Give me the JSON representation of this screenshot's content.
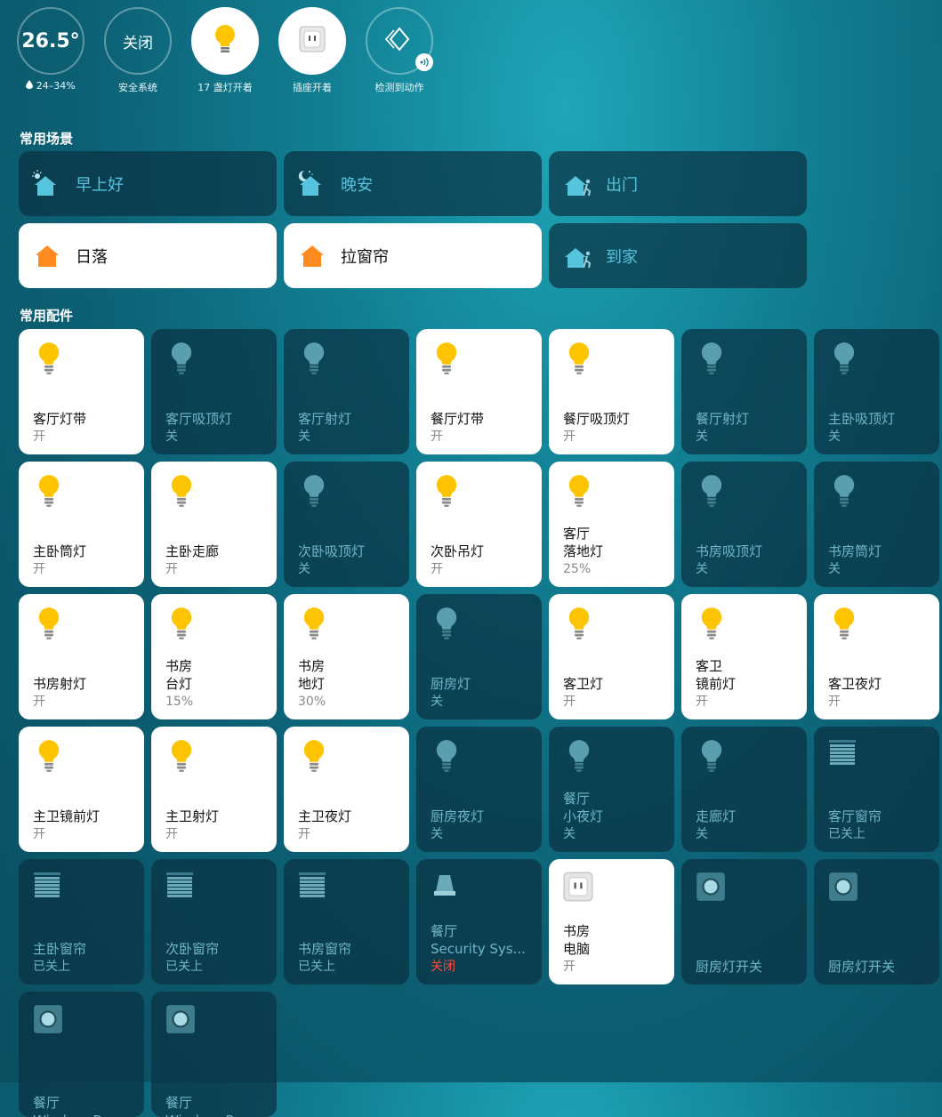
{
  "status": {
    "temperature": "26.5°",
    "humidity": "24–34%",
    "security_value": "关闭",
    "security_label": "安全系统",
    "lights_label": "17 盏灯开着",
    "outlets_label": "插座开着",
    "motion_label": "检测到动作"
  },
  "sections": {
    "scenes_title": "常用场景",
    "accessories_title": "常用配件"
  },
  "scenes": [
    {
      "label": "早上好",
      "icon": "sunrise-home-icon",
      "on": false
    },
    {
      "label": "晚安",
      "icon": "moon-home-icon",
      "on": false
    },
    {
      "label": "出门",
      "icon": "leave-home-icon",
      "on": false
    },
    {
      "label": "日落",
      "icon": "home-icon",
      "on": true
    },
    {
      "label": "拉窗帘",
      "icon": "home-icon",
      "on": true
    },
    {
      "label": "到家",
      "icon": "arrive-home-icon",
      "on": false
    }
  ],
  "accessories": [
    {
      "room": "",
      "name": "客厅灯带",
      "status": "开",
      "icon": "bulb-icon",
      "on": true
    },
    {
      "room": "",
      "name": "客厅吸顶灯",
      "status": "关",
      "icon": "bulb-icon",
      "on": false
    },
    {
      "room": "",
      "name": "客厅射灯",
      "status": "关",
      "icon": "bulb-icon",
      "on": false
    },
    {
      "room": "",
      "name": "餐厅灯带",
      "status": "开",
      "icon": "bulb-icon",
      "on": true
    },
    {
      "room": "",
      "name": "餐厅吸顶灯",
      "status": "开",
      "icon": "bulb-icon",
      "on": true
    },
    {
      "room": "",
      "name": "餐厅射灯",
      "status": "关",
      "icon": "bulb-icon",
      "on": false
    },
    {
      "room": "",
      "name": "主卧吸顶灯",
      "status": "关",
      "icon": "bulb-icon",
      "on": false
    },
    {
      "room": "",
      "name": "主卧筒灯",
      "status": "开",
      "icon": "bulb-icon",
      "on": true
    },
    {
      "room": "",
      "name": "主卧走廊",
      "status": "开",
      "icon": "bulb-icon",
      "on": true
    },
    {
      "room": "",
      "name": "次卧吸顶灯",
      "status": "关",
      "icon": "bulb-icon",
      "on": false
    },
    {
      "room": "",
      "name": "次卧吊灯",
      "status": "开",
      "icon": "bulb-icon",
      "on": true
    },
    {
      "room": "客厅",
      "name": "落地灯",
      "status": "25%",
      "icon": "bulb-icon",
      "on": true
    },
    {
      "room": "",
      "name": "书房吸顶灯",
      "status": "关",
      "icon": "bulb-icon",
      "on": false
    },
    {
      "room": "",
      "name": "书房筒灯",
      "status": "关",
      "icon": "bulb-icon",
      "on": false
    },
    {
      "room": "",
      "name": "书房射灯",
      "status": "开",
      "icon": "bulb-icon",
      "on": true
    },
    {
      "room": "书房",
      "name": "台灯",
      "status": "15%",
      "icon": "bulb-icon",
      "on": true
    },
    {
      "room": "书房",
      "name": "地灯",
      "status": "30%",
      "icon": "bulb-icon",
      "on": true
    },
    {
      "room": "",
      "name": "厨房灯",
      "status": "关",
      "icon": "bulb-icon",
      "on": false
    },
    {
      "room": "",
      "name": "客卫灯",
      "status": "开",
      "icon": "bulb-icon",
      "on": true
    },
    {
      "room": "客卫",
      "name": "镜前灯",
      "status": "开",
      "icon": "bulb-icon",
      "on": true
    },
    {
      "room": "",
      "name": "客卫夜灯",
      "status": "开",
      "icon": "bulb-icon",
      "on": true
    },
    {
      "room": "",
      "name": "主卫镜前灯",
      "status": "开",
      "icon": "bulb-icon",
      "on": true
    },
    {
      "room": "",
      "name": "主卫射灯",
      "status": "开",
      "icon": "bulb-icon",
      "on": true
    },
    {
      "room": "",
      "name": "主卫夜灯",
      "status": "开",
      "icon": "bulb-icon",
      "on": true
    },
    {
      "room": "",
      "name": "厨房夜灯",
      "status": "关",
      "icon": "bulb-icon",
      "on": false
    },
    {
      "room": "餐厅",
      "name": "小夜灯",
      "status": "关",
      "icon": "bulb-icon",
      "on": false
    },
    {
      "room": "",
      "name": "走廊灯",
      "status": "关",
      "icon": "bulb-icon",
      "on": false
    },
    {
      "room": "",
      "name": "客厅窗帘",
      "status": "已关上",
      "icon": "blinds-icon",
      "on": false
    },
    {
      "room": "",
      "name": "主卧窗帘",
      "status": "已关上",
      "icon": "blinds-icon",
      "on": false
    },
    {
      "room": "",
      "name": "次卧窗帘",
      "status": "已关上",
      "icon": "blinds-icon",
      "on": false
    },
    {
      "room": "",
      "name": "书房窗帘",
      "status": "已关上",
      "icon": "blinds-icon",
      "on": false
    },
    {
      "room": "餐厅",
      "name": "Security Sys...",
      "status": "关闭",
      "icon": "security-system-icon",
      "on": false,
      "alert": true
    },
    {
      "room": "书房",
      "name": "电脑",
      "status": "开",
      "icon": "outlet-icon",
      "on": true
    },
    {
      "room": "",
      "name": "厨房灯开关",
      "status": "",
      "icon": "switch-icon",
      "on": false
    },
    {
      "room": "",
      "name": "厨房灯开关",
      "status": "",
      "icon": "switch-icon",
      "on": false
    },
    {
      "room": "餐厅",
      "name": "Wireless Po...",
      "status": "",
      "icon": "switch-icon",
      "on": false,
      "cut": true
    },
    {
      "room": "餐厅",
      "name": "Wireless Po...",
      "status": "",
      "icon": "switch-icon",
      "on": false,
      "cut": true
    }
  ],
  "colors": {
    "bulb_on": "#ffc400",
    "bulb_off": "#5a9fb0",
    "scene_accent": "#57c4de",
    "scene_home_on": "#ff8a1f",
    "alert": "#ff4b3a"
  }
}
